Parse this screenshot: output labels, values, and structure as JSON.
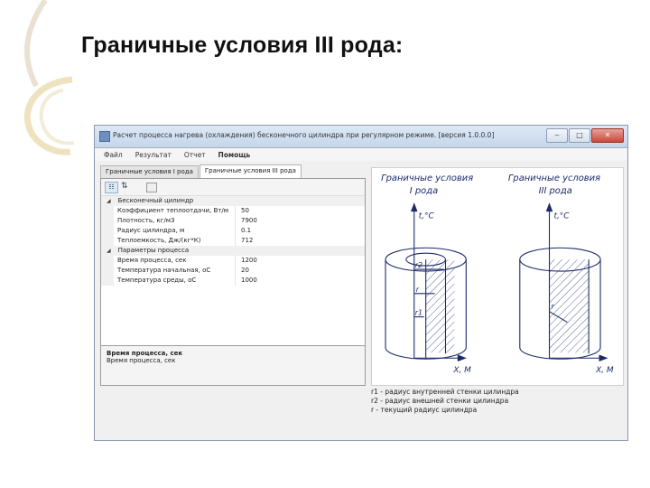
{
  "slide": {
    "title": "Граничные условия III рода:"
  },
  "window": {
    "title": "Расчет процесса нагрева (охлаждения) бесконечного цилиндра при регулярном режиме. [версия 1.0.0.0]",
    "buttons": {
      "minimize": "‒",
      "maximize": "□",
      "close": "✕"
    }
  },
  "menu": [
    "Файл",
    "Результат",
    "Отчет",
    "Помощь"
  ],
  "tabs": [
    "Граничные условия I рода",
    "Граничные условия III рода"
  ],
  "property_grid": {
    "categories": [
      {
        "name": "Бесконечный цилиндр",
        "rows": [
          {
            "name": "Коэффициент теплоотдачи, Вт/м",
            "value": "50"
          },
          {
            "name": "Плотность, кг/м3",
            "value": "7900"
          },
          {
            "name": "Радиус цилиндра, м",
            "value": "0.1"
          },
          {
            "name": "Теплоемкость, Дж/(кг*К)",
            "value": "712"
          }
        ]
      },
      {
        "name": "Параметры процесса",
        "rows": [
          {
            "name": "Время процесса, сек",
            "value": "1200"
          },
          {
            "name": "Температура начальная, оС",
            "value": "20"
          },
          {
            "name": "Температура среды, оС",
            "value": "1000"
          }
        ]
      }
    ],
    "description": {
      "title": "Время процесса, сек",
      "text": "Время процесса, сек"
    }
  },
  "diagram": {
    "left_caption_1": "Граничные условия",
    "left_caption_2": "I рода",
    "right_caption_1": "Граничные условия",
    "right_caption_2": "III рода",
    "axis_t": "t,°C",
    "axis_x": "X, M",
    "label_r": "r",
    "label_r1": "r1",
    "label_r2": "r2"
  },
  "legend": [
    "r1 - радиус внутренней стенки цилиндра",
    "r2 - радиус внешней стенки цилиндра",
    "r - текущий радиус цилиндра"
  ]
}
